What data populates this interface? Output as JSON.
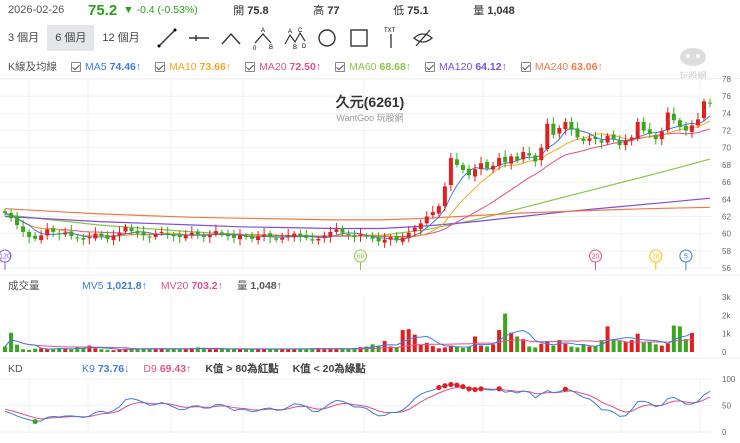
{
  "header": {
    "date": "2026-02-26",
    "price": "75.2",
    "change": "▼ -0.4 (-0.53%)",
    "open_label": "開",
    "open": "75.8",
    "high_label": "高",
    "high": "77",
    "low_label": "低",
    "low": "75.1",
    "vol_label": "量",
    "vol": "1,048"
  },
  "toolbar": {
    "periods": [
      "3 個月",
      "6 個月",
      "12 個月"
    ],
    "active": 1,
    "tools": [
      "line-tool-icon",
      "horizontal-line-tool-icon",
      "angle-tool-icon",
      "abc-pattern-tool-icon",
      "abcd-pattern-tool-icon",
      "circle-tool-icon",
      "rectangle-tool-icon",
      "text-tool-icon",
      "hide-drawings-icon"
    ]
  },
  "ma_legend": {
    "title": "K線及均線",
    "items": [
      {
        "name": "MA5",
        "value": "74.46↑",
        "color": "#3b7ddd"
      },
      {
        "name": "MA10",
        "value": "73.66↑",
        "color": "#f5a623"
      },
      {
        "name": "MA20",
        "value": "72.50↑",
        "color": "#e0508a"
      },
      {
        "name": "MA60",
        "value": "68.68↑",
        "color": "#8bc34a"
      },
      {
        "name": "MA120",
        "value": "64.12↑",
        "color": "#7b4fe0"
      },
      {
        "name": "MA240",
        "value": "63.06↑",
        "color": "#f07848"
      }
    ]
  },
  "chart_title": "久元(6261)",
  "watermark": "WantGoo 玩股網",
  "logo_text": "玩股網",
  "vol_legend": {
    "title": "成交量",
    "mv5_name": "MV5",
    "mv5": "1,021.8↑",
    "mv20_name": "MV20",
    "mv20": "703.2↑",
    "vol_name": "量",
    "vol": "1,048↑"
  },
  "kd_legend": {
    "title": "KD",
    "k_name": "K9",
    "k": "73.76↓",
    "d_name": "D9",
    "d": "69.43↑",
    "note1": "K值 > 80為紅點",
    "note2": "K值 < 20為綠點"
  },
  "chart_data": {
    "type": "candlestick",
    "price_ticks": [
      "78",
      "76",
      "74",
      "72",
      "70",
      "68",
      "66",
      "64",
      "62",
      "60",
      "58",
      "56"
    ],
    "vol_ticks": [
      "3k",
      "2k",
      "1k",
      "0"
    ],
    "kd_ticks": [
      "100",
      "50",
      "0"
    ],
    "ylim": [
      56,
      78
    ],
    "closes": [
      62.4,
      61.8,
      61.0,
      60.2,
      59.6,
      59.4,
      59.8,
      60.5,
      60.2,
      59.9,
      60.1,
      59.7,
      59.5,
      59.3,
      59.6,
      60.0,
      59.7,
      59.4,
      59.8,
      60.1,
      60.8,
      60.3,
      60.0,
      59.8,
      59.6,
      60.0,
      60.2,
      59.9,
      59.7,
      59.6,
      59.8,
      60.1,
      59.9,
      59.6,
      59.8,
      60.3,
      60.0,
      59.7,
      59.5,
      59.8,
      59.6,
      59.4,
      59.7,
      59.9,
      59.6,
      59.3,
      59.5,
      59.8,
      60.0,
      59.7,
      59.5,
      59.2,
      59.4,
      59.8,
      60.2,
      60.5,
      60.1,
      59.8,
      59.6,
      59.9,
      59.7,
      59.4,
      59.1,
      59.3,
      59.6,
      59.2,
      59.5,
      60.1,
      60.7,
      61.2,
      62.0,
      62.5,
      63.2,
      65.5,
      68.8,
      68.0,
      67.4,
      66.8,
      67.5,
      68.2,
      67.6,
      67.9,
      68.8,
      68.3,
      69.0,
      68.5,
      69.5,
      69.1,
      68.4,
      70.0,
      72.8,
      71.5,
      72.3,
      73.0,
      72.1,
      71.2,
      70.8,
      71.1,
      71.0,
      70.6,
      71.4,
      71.0,
      70.3,
      70.8,
      71.2,
      73.0,
      72.0,
      71.6,
      71.0,
      71.9,
      74.1,
      73.2,
      72.4,
      72.0,
      72.6,
      73.3,
      75.4,
      75.2
    ],
    "volumes": [
      300,
      1050,
      400,
      150,
      120,
      180,
      200,
      160,
      150,
      220,
      180,
      150,
      260,
      200,
      350,
      200,
      150,
      120,
      100,
      150,
      180,
      200,
      160,
      170,
      150,
      180,
      200,
      150,
      160,
      170,
      180,
      200,
      250,
      220,
      150,
      170,
      180,
      150,
      160,
      140,
      150,
      170,
      180,
      160,
      150,
      140,
      170,
      190,
      180,
      160,
      150,
      200,
      220,
      180,
      170,
      160,
      180,
      200,
      220,
      260,
      300,
      420,
      350,
      600,
      300,
      250,
      1200,
      1250,
      950,
      400,
      500,
      320,
      200,
      250,
      350,
      300,
      220,
      280,
      850,
      350,
      300,
      420,
      1200,
      2100,
      1050,
      850,
      700,
      300,
      250,
      450,
      600,
      350,
      650,
      450,
      300,
      250,
      400,
      300,
      320,
      650,
      1400,
      700,
      600,
      550,
      650,
      1000,
      500,
      550,
      420,
      350,
      450,
      1450,
      1400,
      700,
      1048
    ],
    "ma_long": {
      "MA60": [
        62.2,
        61.6,
        61.0,
        60.6,
        60.2,
        59.9,
        59.8,
        59.7,
        59.8,
        60.5,
        61.6,
        63.0,
        64.4,
        65.8,
        67.2,
        68.68
      ],
      "MA120": [
        62.0,
        61.7,
        61.4,
        61.2,
        61.0,
        60.8,
        60.7,
        60.6,
        60.6,
        60.9,
        61.4,
        62.0,
        62.6,
        63.1,
        63.6,
        64.12
      ],
      "MA240": [
        62.9,
        62.6,
        62.3,
        62.1,
        61.9,
        61.8,
        61.7,
        61.6,
        61.6,
        61.8,
        62.1,
        62.4,
        62.6,
        62.8,
        62.95,
        63.06
      ]
    },
    "markers": [
      {
        "label": "120",
        "index": 0,
        "color": "#8a5fd6"
      },
      {
        "label": "60",
        "index": 59,
        "color": "#8bc34a"
      },
      {
        "label": "20",
        "index": 98,
        "color": "#e0508a"
      },
      {
        "label": "10",
        "index": 108,
        "color": "#f5c400"
      },
      {
        "label": "5",
        "index": 113,
        "color": "#3b7ddd"
      }
    ],
    "up_color": "#e02020",
    "down_color": "#3aa81e"
  }
}
